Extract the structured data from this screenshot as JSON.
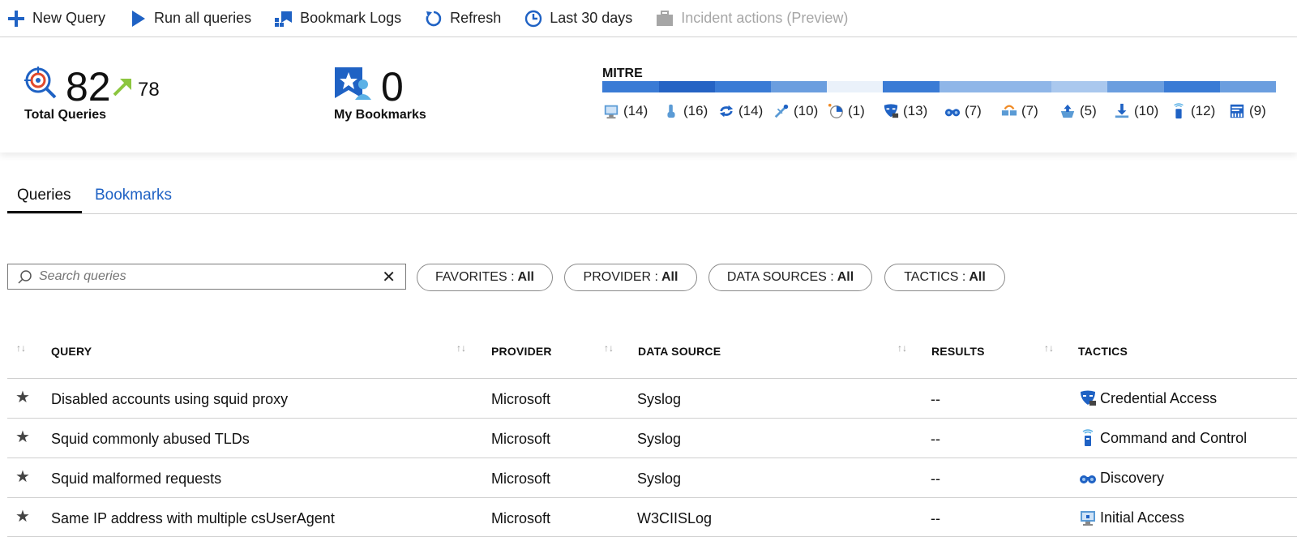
{
  "toolbar": {
    "new_query": "New Query",
    "run_all": "Run all queries",
    "bookmark_logs": "Bookmark Logs",
    "refresh": "Refresh",
    "time_range": "Last 30 days",
    "incident_actions": "Incident actions (Preview)"
  },
  "summary": {
    "total_queries": {
      "value": "82",
      "delta": "78",
      "label": "Total Queries"
    },
    "bookmarks": {
      "value": "0",
      "label": "My Bookmarks"
    },
    "mitre": {
      "title": "MITRE",
      "items": [
        {
          "icon": "initial-access-icon",
          "count": "(14)"
        },
        {
          "icon": "execution-icon",
          "count": "(16)"
        },
        {
          "icon": "persistence-icon",
          "count": "(14)"
        },
        {
          "icon": "privilege-escalation-icon",
          "count": "(10)"
        },
        {
          "icon": "defense-evasion-icon",
          "count": "(1)"
        },
        {
          "icon": "credential-access-icon",
          "count": "(13)"
        },
        {
          "icon": "discovery-icon",
          "count": "(7)"
        },
        {
          "icon": "lateral-movement-icon",
          "count": "(7)"
        },
        {
          "icon": "collection-icon",
          "count": "(5)"
        },
        {
          "icon": "exfiltration-icon",
          "count": "(10)"
        },
        {
          "icon": "command-and-control-icon",
          "count": "(12)"
        },
        {
          "icon": "impact-icon",
          "count": "(9)"
        }
      ],
      "bar_colors": [
        "#3a7bd5",
        "#2563c4",
        "#3a7bd5",
        "#6b9edf",
        "#eaf1fa",
        "#3a7bd5",
        "#8fb6e8",
        "#8fb6e8",
        "#aac8ee",
        "#6b9edf",
        "#3a7bd5",
        "#6b9edf"
      ]
    }
  },
  "tabs": {
    "queries": "Queries",
    "bookmarks": "Bookmarks"
  },
  "search": {
    "placeholder": "Search queries"
  },
  "filters": [
    {
      "name": "FAVORITES",
      "value": "All"
    },
    {
      "name": "PROVIDER",
      "value": "All"
    },
    {
      "name": "DATA SOURCES",
      "value": "All"
    },
    {
      "name": "TACTICS",
      "value": "All"
    }
  ],
  "table": {
    "headers": {
      "query": "QUERY",
      "provider": "PROVIDER",
      "data_source": "DATA SOURCE",
      "results": "RESULTS",
      "tactics": "TACTICS"
    },
    "rows": [
      {
        "query": "Disabled accounts using squid proxy",
        "provider": "Microsoft",
        "data_source": "Syslog",
        "results": "--",
        "tactic": "Credential Access",
        "tactic_icon": "credential-access-icon"
      },
      {
        "query": "Squid commonly abused TLDs",
        "provider": "Microsoft",
        "data_source": "Syslog",
        "results": "--",
        "tactic": "Command and Control",
        "tactic_icon": "command-and-control-icon"
      },
      {
        "query": "Squid malformed requests",
        "provider": "Microsoft",
        "data_source": "Syslog",
        "results": "--",
        "tactic": "Discovery",
        "tactic_icon": "discovery-icon"
      },
      {
        "query": "Same IP address with multiple csUserAgent",
        "provider": "Microsoft",
        "data_source": "W3CIISLog",
        "results": "--",
        "tactic": "Initial Access",
        "tactic_icon": "initial-access-icon"
      }
    ]
  }
}
